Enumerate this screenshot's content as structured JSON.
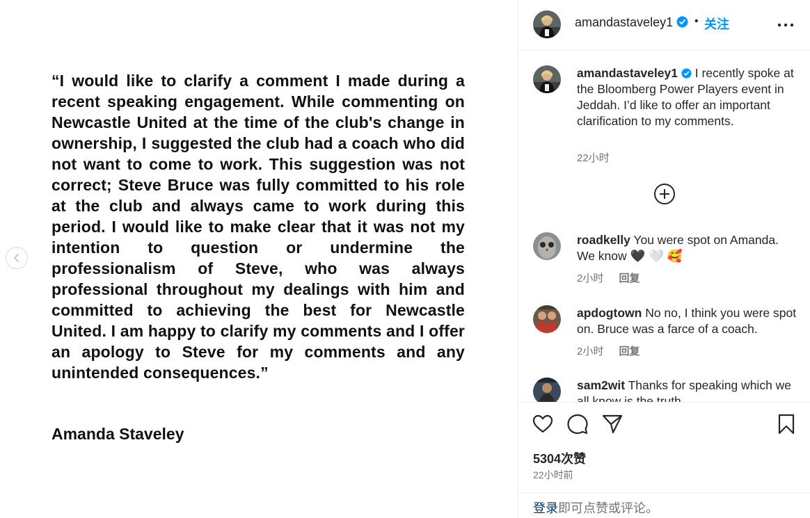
{
  "post": {
    "statement": "“I would like to clarify a comment I made during a recent speaking engagement. While commenting on Newcastle United at the time of the club's change in ownership, I suggested the club had a coach who did not want to come to work. This suggestion was not correct; Steve Bruce was fully committed to his role at the club and always came to work during this period. I would like to make clear that it was not my intention to question or undermine the professionalism of Steve, who was always professional throughout my dealings with him and committed to achieving the best for Newcastle United. I am happy to clarify my comments and I offer an apology to Steve for my comments and any unintended consequences.”",
    "signature": "Amanda Staveley"
  },
  "header": {
    "username": "amandastaveley1",
    "separator": "•",
    "follow_label": "关注"
  },
  "caption": {
    "username": "amandastaveley1",
    "text": "I recently spoke at the Bloomberg Power Players event in Jeddah. I’d like to offer an important clarification to my comments.",
    "time": "22小时"
  },
  "comments": [
    {
      "username": "roadkelly",
      "text": "You were spot on Amanda. We know",
      "emoji": [
        "🖤",
        "🤍",
        "🥰"
      ],
      "time": "2小时",
      "reply_label": "回复"
    },
    {
      "username": "apdogtown",
      "text": "No no, I think you were spot on. Bruce was a farce of a coach.",
      "time": "2小时",
      "reply_label": "回复"
    },
    {
      "username": "sam2wit",
      "text": "Thanks for speaking which we all know is the truth",
      "time": "",
      "reply_label": ""
    }
  ],
  "footer": {
    "likes": "5304次赞",
    "time": "22小时前",
    "login_link": "登录",
    "login_text": "即可点赞或评论。"
  },
  "icons": {
    "verified": "verified-badge-icon",
    "more": "more-options-icon",
    "load_more": "plus-circle-icon",
    "like": "heart-icon",
    "comment": "comment-icon",
    "share": "send-icon",
    "save": "bookmark-icon",
    "prev": "chevron-left-icon"
  },
  "colors": {
    "accent": "#0095f6",
    "verified": "#0095f6",
    "secondary_text": "#737373",
    "link": "#00376b"
  }
}
